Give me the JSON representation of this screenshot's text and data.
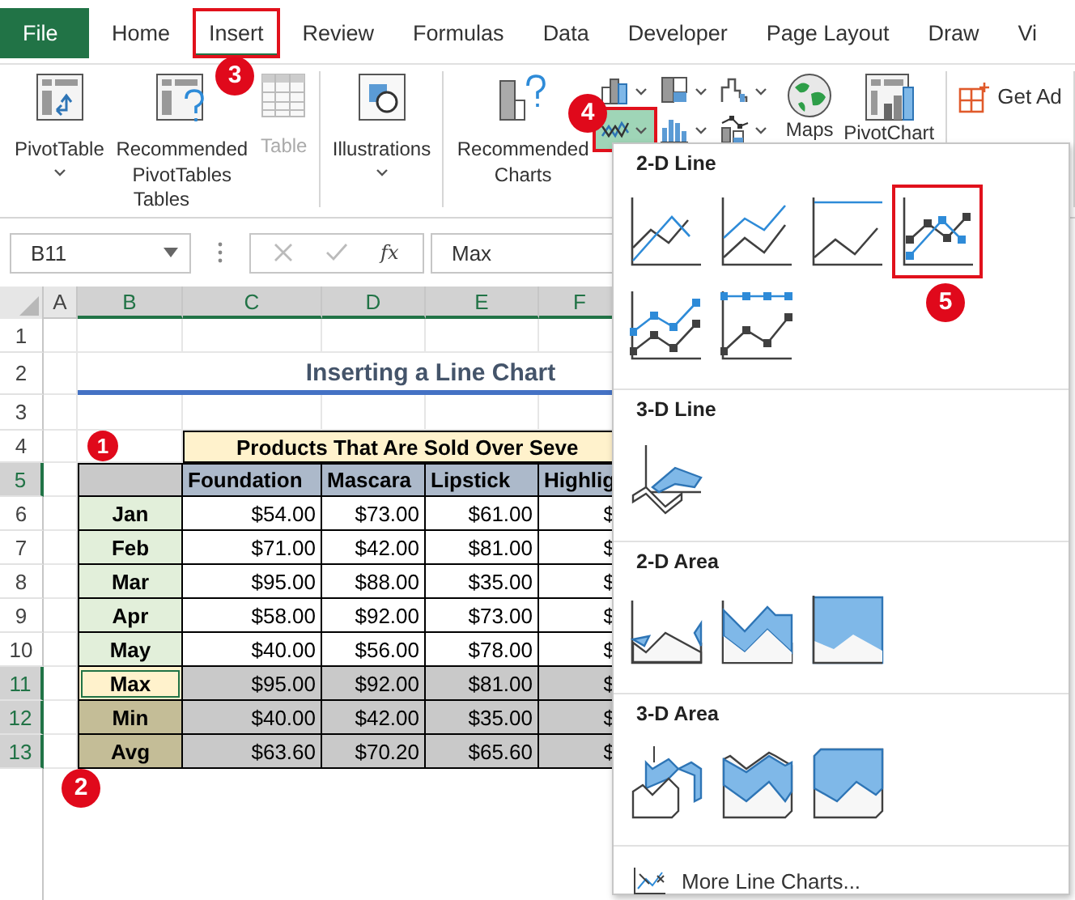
{
  "tabs": [
    {
      "label": "File",
      "kind": "file",
      "selected": false
    },
    {
      "label": "Home",
      "kind": "tab",
      "selected": false
    },
    {
      "label": "Insert",
      "kind": "tab",
      "selected": true,
      "annotated": true
    },
    {
      "label": "Review",
      "kind": "tab",
      "selected": false
    },
    {
      "label": "Formulas",
      "kind": "tab",
      "selected": false
    },
    {
      "label": "Data",
      "kind": "tab",
      "selected": false
    },
    {
      "label": "Developer",
      "kind": "tab",
      "selected": false
    },
    {
      "label": "Page Layout",
      "kind": "tab",
      "selected": false
    },
    {
      "label": "Draw",
      "kind": "tab",
      "selected": false
    },
    {
      "label": "Vi",
      "kind": "tab",
      "selected": false
    }
  ],
  "ribbon": {
    "groups": [
      {
        "label": "Tables",
        "buttons": [
          {
            "label": "PivotTable",
            "dropdown": true,
            "disabled": false
          },
          {
            "label": "Recommended PivotTables",
            "dropdown": false,
            "disabled": false
          },
          {
            "label": "Table",
            "dropdown": false,
            "disabled": true
          }
        ]
      },
      {
        "buttons": [
          {
            "label": "Illustrations",
            "dropdown": true,
            "disabled": false
          }
        ]
      },
      {
        "buttons": [
          {
            "label": "Recommended Charts",
            "dropdown": false,
            "disabled": false
          }
        ],
        "chart_buttons": [
          {
            "selected": false,
            "annotated": false
          },
          {
            "selected": false,
            "annotated": false
          },
          {
            "selected": false,
            "annotated": false
          },
          {
            "selected": true,
            "annotated": true
          },
          {
            "selected": false,
            "annotated": false
          },
          {
            "selected": false,
            "annotated": false
          }
        ],
        "more_buttons": [
          {
            "label": "Maps",
            "dropdown": false,
            "disabled": false
          },
          {
            "label": "PivotChart",
            "dropdown": false,
            "disabled": false
          }
        ]
      },
      {
        "buttons": [
          {
            "label": "Get Ad",
            "dropdown": false,
            "disabled": false
          }
        ]
      }
    ]
  },
  "formula_bar": {
    "name_box": "B11",
    "function_label": "fx",
    "formula": "Max"
  },
  "sheet": {
    "column_headers": [
      {
        "label": "A",
        "selected": false
      },
      {
        "label": "B",
        "selected": true
      },
      {
        "label": "C",
        "selected": true
      },
      {
        "label": "D",
        "selected": true
      },
      {
        "label": "E",
        "selected": true
      },
      {
        "label": "F",
        "selected": true
      }
    ],
    "row_headers": [
      {
        "label": "1",
        "selected": false
      },
      {
        "label": "2",
        "selected": false
      },
      {
        "label": "3",
        "selected": false
      },
      {
        "label": "4",
        "selected": false
      },
      {
        "label": "5",
        "selected": true
      },
      {
        "label": "6",
        "selected": false
      },
      {
        "label": "7",
        "selected": false
      },
      {
        "label": "8",
        "selected": false
      },
      {
        "label": "9",
        "selected": false
      },
      {
        "label": "10",
        "selected": false
      },
      {
        "label": "11",
        "selected": true
      },
      {
        "label": "12",
        "selected": true
      },
      {
        "label": "13",
        "selected": true
      }
    ],
    "title": "Inserting a Line Chart",
    "table_title": "Products That Are Sold Over Seve",
    "table_columns": [
      "Foundation",
      "Mascara",
      "Lipstick",
      "Highlig"
    ],
    "table_rows": [
      {
        "label": "Jan",
        "kind": "month",
        "selected": false,
        "values": [
          "$54.00",
          "$73.00",
          "$61.00",
          "$"
        ]
      },
      {
        "label": "Feb",
        "kind": "month",
        "selected": false,
        "values": [
          "$71.00",
          "$42.00",
          "$81.00",
          "$"
        ]
      },
      {
        "label": "Mar",
        "kind": "month",
        "selected": false,
        "values": [
          "$95.00",
          "$88.00",
          "$35.00",
          "$"
        ]
      },
      {
        "label": "Apr",
        "kind": "month",
        "selected": false,
        "values": [
          "$58.00",
          "$92.00",
          "$73.00",
          "$"
        ]
      },
      {
        "label": "May",
        "kind": "month",
        "selected": false,
        "values": [
          "$40.00",
          "$56.00",
          "$78.00",
          "$"
        ]
      },
      {
        "label": "Max",
        "kind": "stat",
        "selected": true,
        "values": [
          "$95.00",
          "$92.00",
          "$81.00",
          "$"
        ]
      },
      {
        "label": "Min",
        "kind": "stat",
        "selected": false,
        "values": [
          "$40.00",
          "$42.00",
          "$35.00",
          "$"
        ]
      },
      {
        "label": "Avg",
        "kind": "stat",
        "selected": false,
        "values": [
          "$63.60",
          "$70.20",
          "$65.60",
          "$"
        ]
      }
    ]
  },
  "chart_menu": {
    "sections": [
      {
        "title": "2-D Line",
        "items": [
          {
            "kind": "line",
            "annotated": false
          },
          {
            "kind": "stacked-line",
            "annotated": false
          },
          {
            "kind": "full-line",
            "annotated": false
          },
          {
            "kind": "line-markers",
            "annotated": true
          },
          {
            "kind": "stacked-line-markers",
            "annotated": false
          },
          {
            "kind": "full-line-markers",
            "annotated": false
          }
        ]
      },
      {
        "title": "3-D Line",
        "items": [
          {
            "kind": "line-3d",
            "annotated": false
          }
        ]
      },
      {
        "title": "2-D Area",
        "items": [
          {
            "kind": "area",
            "annotated": false
          },
          {
            "kind": "stacked-area",
            "annotated": false
          },
          {
            "kind": "full-area",
            "annotated": false
          }
        ]
      },
      {
        "title": "3-D Area",
        "items": [
          {
            "kind": "area-3d",
            "annotated": false
          },
          {
            "kind": "stacked-area-3d",
            "annotated": false
          },
          {
            "kind": "full-area-3d",
            "annotated": false
          }
        ]
      }
    ],
    "more": "More Line Charts..."
  },
  "annotations": [
    {
      "label": "1"
    },
    {
      "label": "2"
    },
    {
      "label": "3"
    },
    {
      "label": "4"
    },
    {
      "label": "5"
    }
  ]
}
